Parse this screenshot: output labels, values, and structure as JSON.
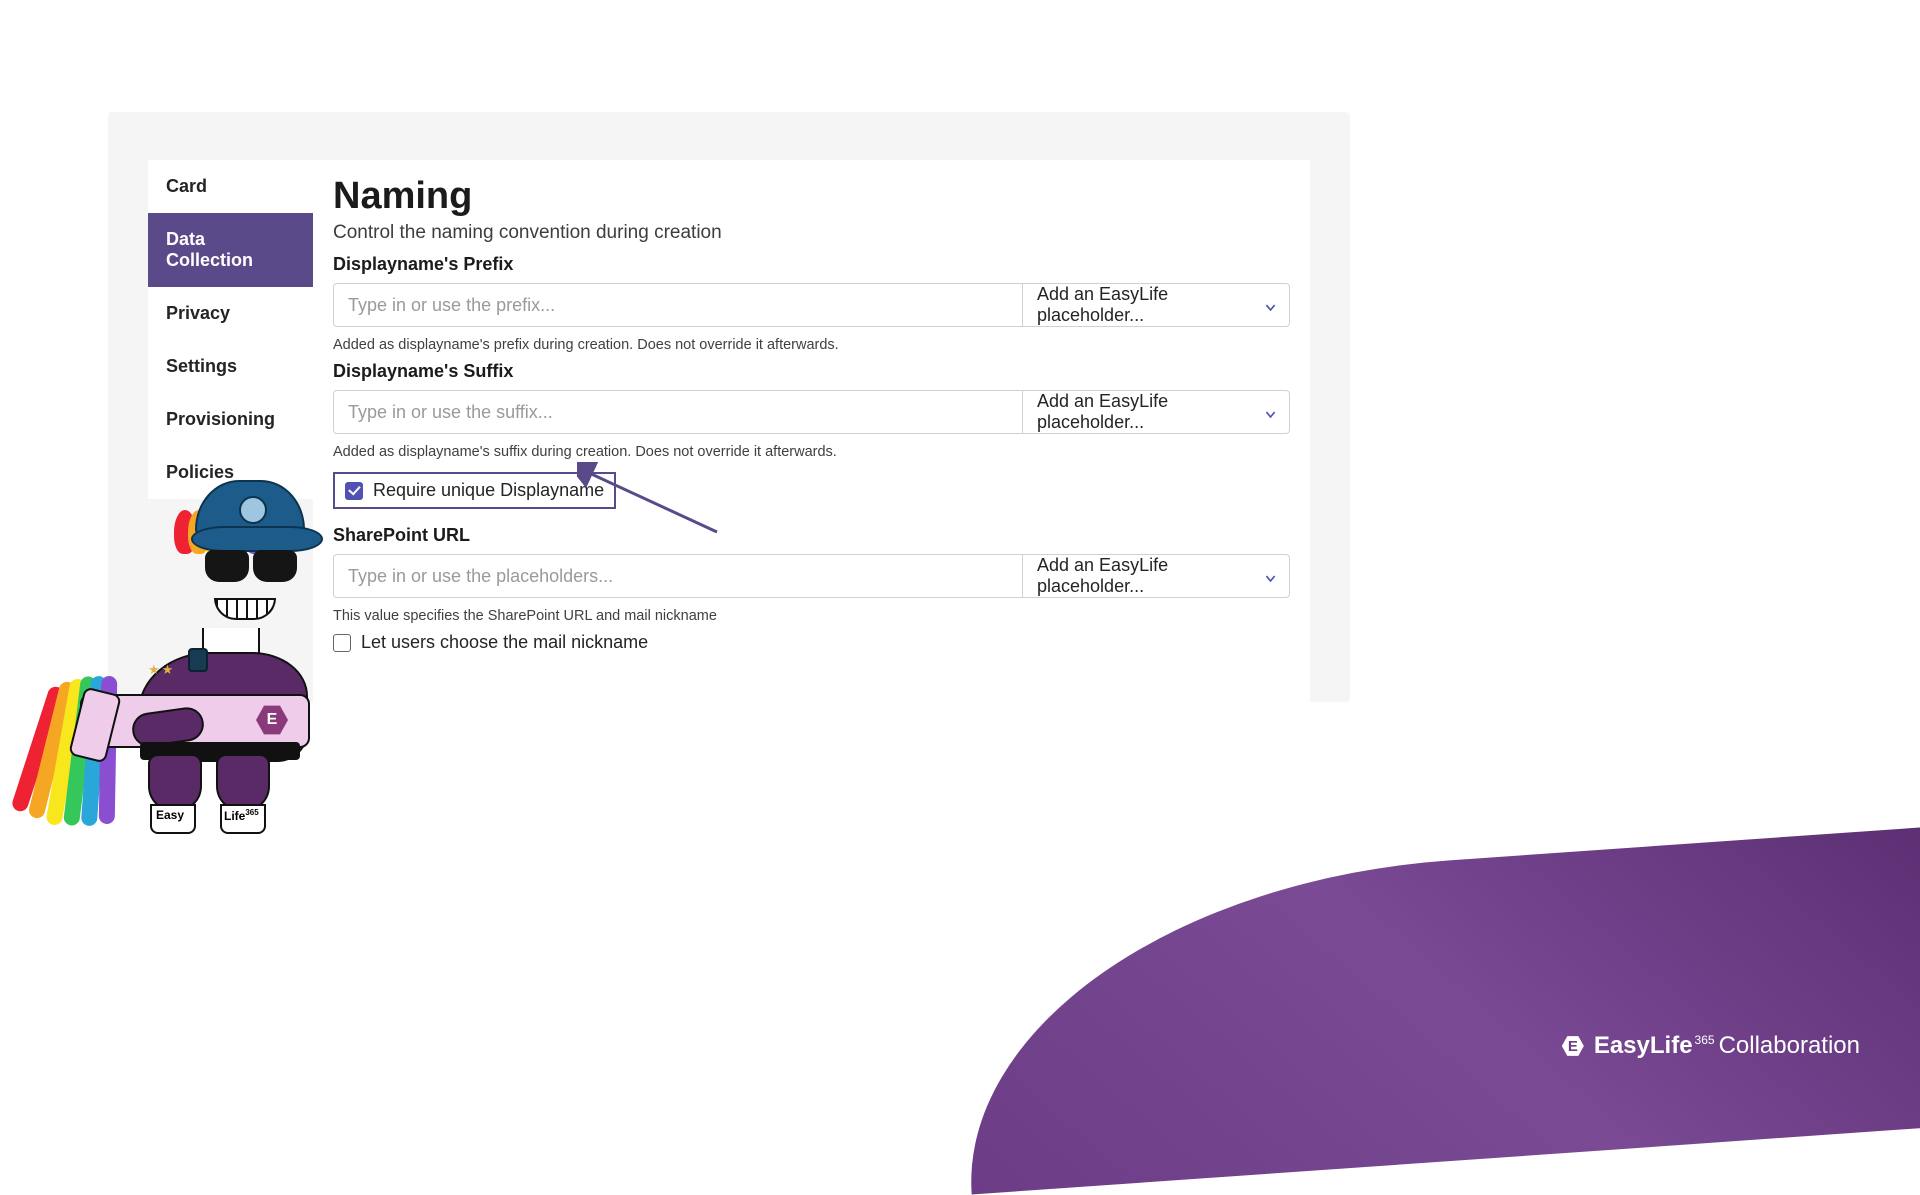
{
  "sidebar": {
    "items": [
      {
        "label": "Card"
      },
      {
        "label": "Data Collection"
      },
      {
        "label": "Privacy"
      },
      {
        "label": "Settings"
      },
      {
        "label": "Provisioning"
      },
      {
        "label": "Policies"
      }
    ],
    "active_index": 1
  },
  "page": {
    "title": "Naming",
    "subtitle": "Control the naming convention during creation"
  },
  "prefix": {
    "label": "Displayname's Prefix",
    "placeholder": "Type in or use the prefix...",
    "dropdown": "Add an EasyLife placeholder...",
    "hint": "Added as displayname's prefix during creation. Does not override it afterwards."
  },
  "suffix": {
    "label": "Displayname's Suffix",
    "placeholder": "Type in or use the suffix...",
    "dropdown": "Add an EasyLife placeholder...",
    "hint": "Added as displayname's suffix during creation. Does not override it afterwards."
  },
  "unique_checkbox": {
    "label": "Require unique Displayname",
    "checked": true
  },
  "sp_url": {
    "label": "SharePoint URL",
    "placeholder": "Type in or use the placeholders...",
    "dropdown": "Add an EasyLife placeholder...",
    "hint": "This value specifies the SharePoint URL and mail nickname"
  },
  "nickname_checkbox": {
    "label": "Let users choose the mail nickname",
    "checked": false
  },
  "brand": {
    "badge_letter": "E",
    "name_bold": "EasyLife",
    "sup": "365",
    "suffix": "Collaboration"
  },
  "mascot": {
    "gun_letter": "E",
    "hoof_left": "Easy",
    "hoof_right": "Life",
    "hoof_right_sup": "365"
  }
}
